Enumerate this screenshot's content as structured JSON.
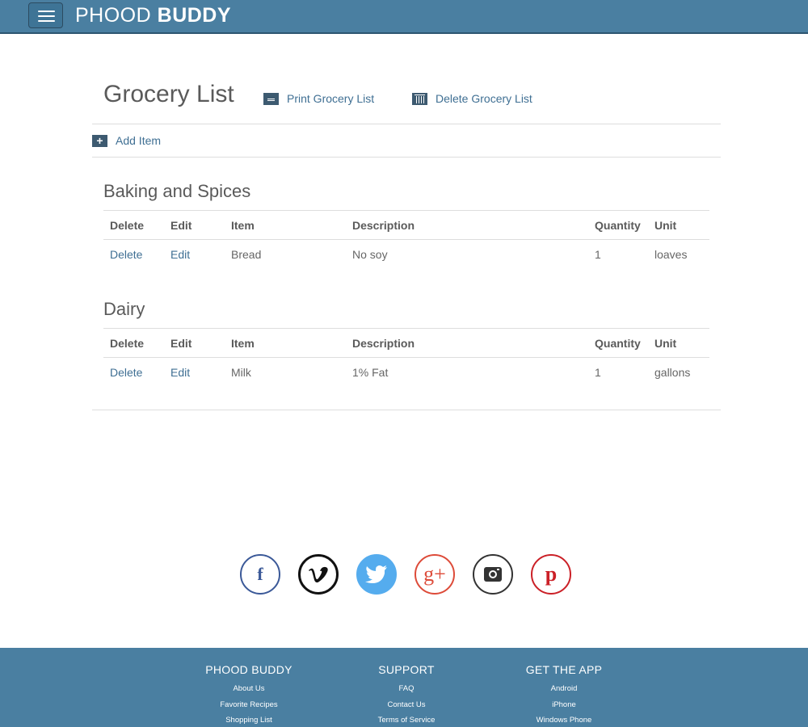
{
  "header": {
    "brand_light": "PHOOD",
    "brand_bold": "BUDDY"
  },
  "page": {
    "title": "Grocery List",
    "print_label": "Print Grocery List",
    "delete_label": "Delete Grocery List",
    "add_item_label": "Add Item"
  },
  "columns": {
    "delete": "Delete",
    "edit": "Edit",
    "item": "Item",
    "description": "Description",
    "quantity": "Quantity",
    "unit": "Unit"
  },
  "sections": [
    {
      "title": "Baking and Spices",
      "rows": [
        {
          "delete": "Delete",
          "edit": "Edit",
          "item": "Bread",
          "description": "No soy",
          "quantity": "1",
          "unit": "loaves"
        }
      ]
    },
    {
      "title": "Dairy",
      "rows": [
        {
          "delete": "Delete",
          "edit": "Edit",
          "item": "Milk",
          "description": "1% Fat",
          "quantity": "1",
          "unit": "gallons"
        }
      ]
    }
  ],
  "social": {
    "facebook_glyph": "f",
    "vimeo_glyph": "v",
    "google_glyph": "g+",
    "pinterest_glyph": "p",
    "icons": [
      "facebook-icon",
      "vimeo-icon",
      "twitter-icon",
      "google-plus-icon",
      "instagram-icon",
      "pinterest-icon"
    ]
  },
  "footer": {
    "col1": {
      "title": "PHOOD BUDDY",
      "links": [
        "About Us",
        "Favorite Recipes",
        "Shopping List"
      ]
    },
    "col2": {
      "title": "SUPPORT",
      "links": [
        "FAQ",
        "Contact Us",
        "Terms of Service"
      ]
    },
    "col3": {
      "title": "GET THE APP",
      "links": [
        "Android",
        "iPhone",
        "Windows Phone"
      ]
    }
  },
  "colors": {
    "header_bg": "#4a7fa1",
    "link": "#3f6f93",
    "icon_box": "#3d5a70"
  }
}
